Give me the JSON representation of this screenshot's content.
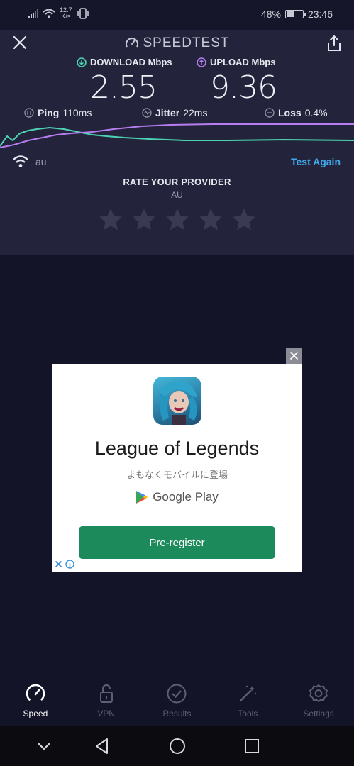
{
  "status_bar": {
    "network_speed": "12.7",
    "network_speed_unit": "K/s",
    "battery_percent": "48%",
    "time": "23:46",
    "battery_level": 0.48
  },
  "header": {
    "brand": "SPEEDTEST"
  },
  "results": {
    "download": {
      "label": "DOWNLOAD Mbps",
      "value": "2.55",
      "color": "#4cd3b4"
    },
    "upload": {
      "label": "UPLOAD Mbps",
      "value": "9.36",
      "color": "#b67ef0"
    },
    "ping": {
      "label": "Ping",
      "value": "110ms"
    },
    "jitter": {
      "label": "Jitter",
      "value": "22ms"
    },
    "loss": {
      "label": "Loss",
      "value": "0.4%"
    }
  },
  "provider": {
    "name": "au",
    "test_again": "Test Again",
    "rate_title": "RATE YOUR PROVIDER",
    "rate_name": "AU",
    "stars_total": 5,
    "stars_selected": 0
  },
  "ad": {
    "title": "League of Legends",
    "subtitle": "まもなくモバイルに登場",
    "store": "Google Play",
    "cta": "Pre-register"
  },
  "tabs": [
    {
      "label": "Speed",
      "icon": "speedometer-icon",
      "active": true
    },
    {
      "label": "VPN",
      "icon": "lock-icon",
      "active": false
    },
    {
      "label": "Results",
      "icon": "check-circle-icon",
      "active": false
    },
    {
      "label": "Tools",
      "icon": "magic-wand-icon",
      "active": false
    },
    {
      "label": "Settings",
      "icon": "gear-icon",
      "active": false
    }
  ],
  "colors": {
    "accent_blue": "#3fa7ea",
    "download": "#4cd3b4",
    "upload": "#b67ef0",
    "cta_green": "#1d8a5b"
  }
}
